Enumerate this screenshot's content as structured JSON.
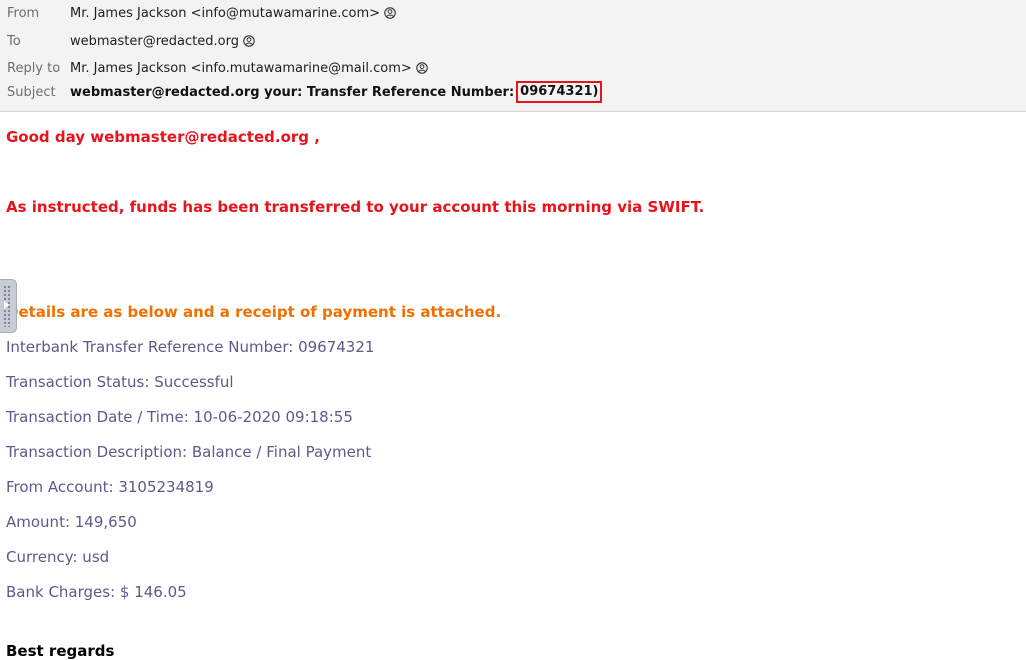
{
  "header": {
    "from_label": "From",
    "from_value": "Mr. James Jackson <info@mutawamarine.com>",
    "to_label": "To",
    "to_value": "webmaster@redacted.org",
    "replyto_label": "Reply to",
    "replyto_value": "Mr. James Jackson <info.mutawamarine@mail.com>",
    "subject_label": "Subject",
    "subject_value": "webmaster@redacted.org your: Transfer Reference Number:",
    "subject_ref": "09674321)"
  },
  "body": {
    "greeting": "Good day webmaster@redacted.org ,",
    "instructed": "As instructed, funds has been transferred to your account this morning via SWIFT.",
    "details_intro": "Details are as below and a receipt of payment is attached.",
    "details": [
      "Interbank Transfer Reference Number: 09674321",
      "Transaction Status: Successful",
      "Transaction Date / Time: 10-06-2020 09:18:55",
      "Transaction Description: Balance / Final Payment",
      "From Account: 3105234819",
      "Amount: 149,650",
      "Currency: usd",
      "Bank Charges: $ 146.05"
    ],
    "closing": "Best regards"
  },
  "icons": {
    "contact": "person-icon",
    "side_handle": "drag-handle-icon"
  },
  "colors": {
    "header_bg": "#f3f3f3",
    "red_text": "#e8141b",
    "orange_text": "#f07000",
    "detail_text": "#5b5b8a",
    "highlight_box": "#e8141b"
  }
}
